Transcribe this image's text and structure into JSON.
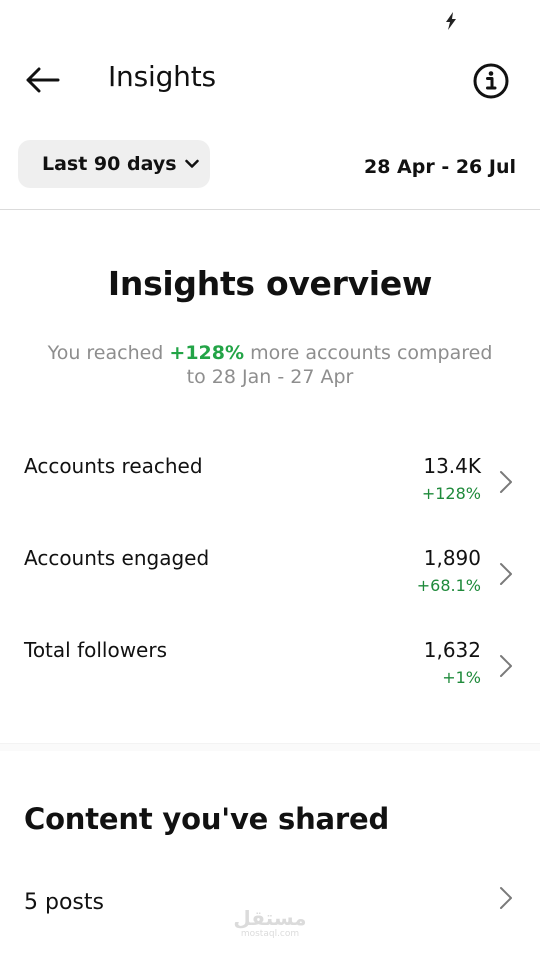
{
  "status_bar": {
    "icon": "charging-bolt-icon"
  },
  "header": {
    "title": "Insights",
    "back_icon": "back-arrow-icon",
    "info_icon": "info-circle-icon"
  },
  "filter": {
    "period_label": "Last 90 days",
    "date_range": "28 Apr - 26 Jul"
  },
  "overview": {
    "title": "Insights overview",
    "subtitle_prefix": "You reached ",
    "subtitle_pct": "+128%",
    "subtitle_suffix": " more accounts compared to 28 Jan - 27 Apr"
  },
  "metrics": [
    {
      "label": "Accounts reached",
      "value": "13.4K",
      "change": "+128%"
    },
    {
      "label": "Accounts engaged",
      "value": "1,890",
      "change": "+68.1%"
    },
    {
      "label": "Total followers",
      "value": "1,632",
      "change": "+1%"
    }
  ],
  "content": {
    "title": "Content you've shared",
    "posts_label": "5 posts"
  },
  "watermark": {
    "logo": "مستقل",
    "text": "mostaql.com"
  },
  "colors": {
    "positive_change": "#1f8a3b",
    "subtitle_gray": "#8e8e8e",
    "dropdown_bg": "#efefef"
  }
}
